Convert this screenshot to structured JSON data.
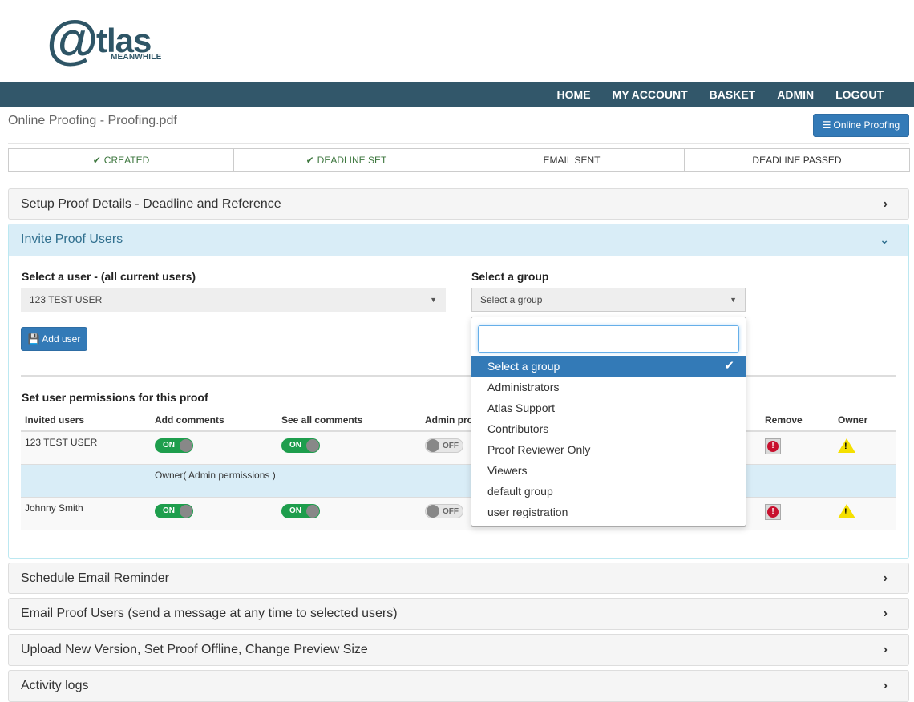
{
  "logo": {
    "mark": "@",
    "name": "tlas",
    "sub": "MEANWHILE"
  },
  "nav": [
    "HOME",
    "MY ACCOUNT",
    "BASKET",
    "ADMIN",
    "LOGOUT"
  ],
  "page_title": "Online Proofing - Proofing.pdf",
  "online_proofing_button": "Online Proofing",
  "steps": [
    {
      "label": "CREATED",
      "done": true
    },
    {
      "label": "DEADLINE SET",
      "done": true
    },
    {
      "label": "EMAIL SENT",
      "done": false
    },
    {
      "label": "DEADLINE PASSED",
      "done": false
    }
  ],
  "panels": {
    "setup": "Setup Proof Details - Deadline and Reference",
    "invite": "Invite Proof Users",
    "schedule": "Schedule Email Reminder",
    "email": "Email Proof Users (send a message at any time to selected users)",
    "upload": "Upload New Version, Set Proof Offline, Change Preview Size",
    "logs": "Activity logs"
  },
  "invite": {
    "user_label": "Select a user - (all current users)",
    "user_value": "123 TEST USER",
    "add_user": "Add user",
    "group_label": "Select a group",
    "group_value": "Select a group",
    "perm_title": "Set user permissions for this proof",
    "columns": [
      "Invited users",
      "Add comments",
      "See all comments",
      "Admin pro",
      "Remove",
      "Owner"
    ],
    "rows": [
      {
        "name": "123 TEST USER",
        "add": "ON",
        "see": "ON",
        "admin": "OFF"
      },
      {
        "name": "Johnny Smith",
        "add": "ON",
        "see": "ON",
        "admin": "OFF"
      }
    ],
    "owner_note": "Owner( Admin permissions )"
  },
  "dropdown": {
    "options": [
      "Select a group",
      "Administrators",
      "Atlas Support",
      "Contributors",
      "Proof Reviewer Only",
      "Viewers",
      "default group",
      "user registration"
    ],
    "selected": "Select a group"
  },
  "icons": {
    "remove": "!",
    "owner": "!"
  }
}
